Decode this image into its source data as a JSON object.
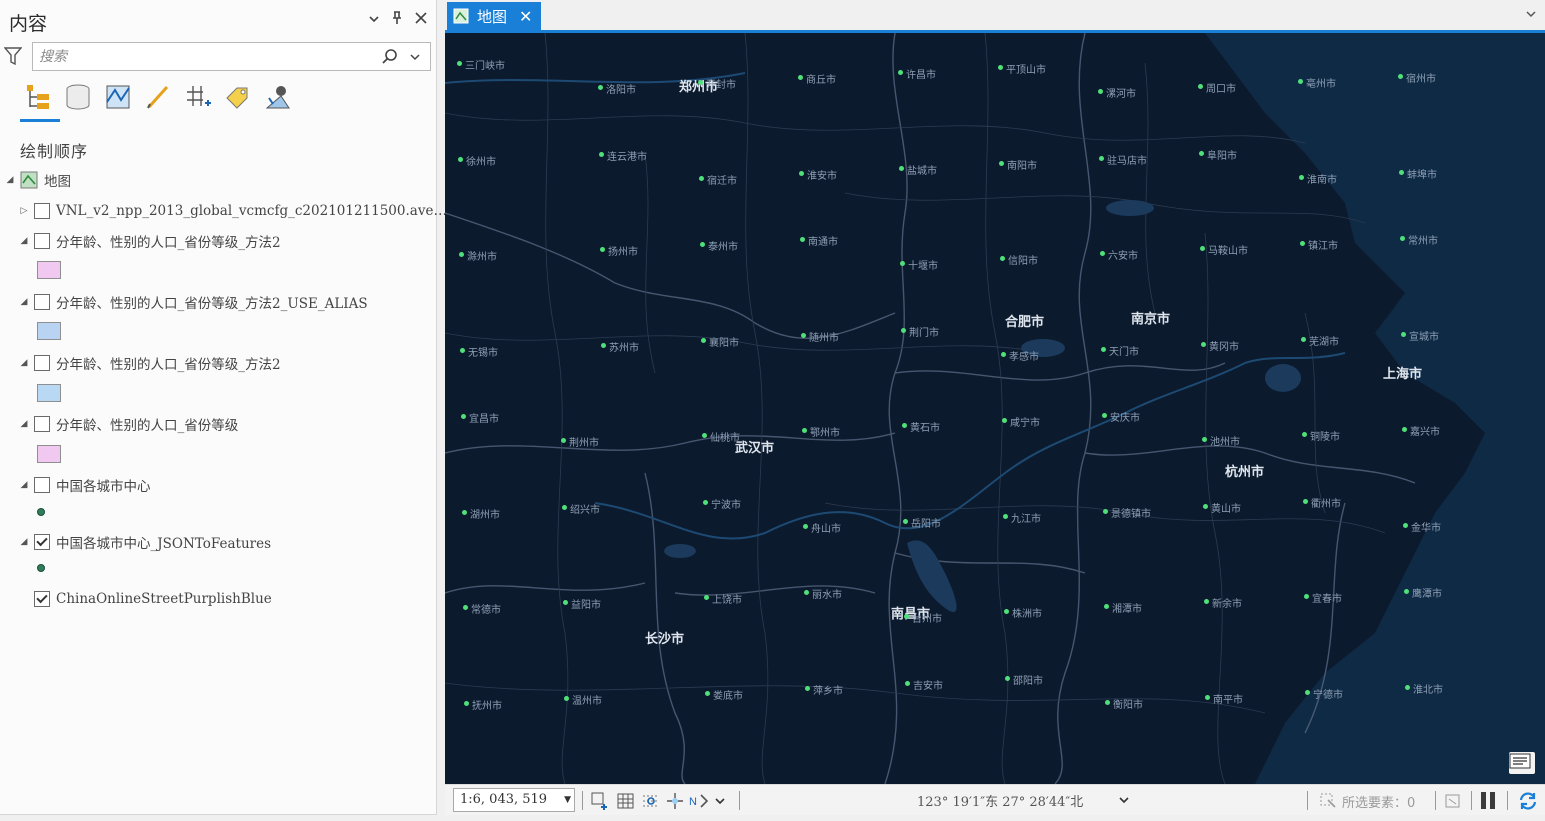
{
  "contents_pane": {
    "title": "内容",
    "search_placeholder": "搜索",
    "section_title": "绘制顺序",
    "map_node": "地图",
    "layers": [
      {
        "label": "VNL_v2_npp_2013_global_vcmcfg_c202101211500.ave…",
        "checked": false
      },
      {
        "label": "分年龄、性别的人口_省份等级_方法2",
        "checked": false,
        "swatch": "#f0c8f0"
      },
      {
        "label": "分年龄、性别的人口_省份等级_方法2_USE_ALIAS",
        "checked": false,
        "swatch": "#b8d4f2"
      },
      {
        "label": "分年龄、性别的人口_省份等级_方法2",
        "checked": false,
        "swatch": "#b8d8f4"
      },
      {
        "label": "分年龄、性别的人口_省份等级",
        "checked": false,
        "swatch": "#f0c8f0"
      },
      {
        "label": "中国各城市中心",
        "checked": false
      },
      {
        "label": "中国各城市中心_JSONToFeatures",
        "checked": true
      },
      {
        "label": "ChinaOnlineStreetPurplishBlue",
        "checked": true
      }
    ],
    "toolbar_icons": [
      "draw-order-icon",
      "data-source-icon",
      "selection-icon",
      "editing-icon",
      "snapping-icon",
      "labeling-icon",
      "perspective-imagery-icon"
    ]
  },
  "map_view": {
    "tab_label": "地图",
    "scale": "1:6, 043, 519",
    "coordinates": "123°  19′1″东  27°  28′44″北",
    "selected_features": "所选要素：0",
    "cities_major": [
      {
        "name": "郑州市"
      },
      {
        "name": "合肥市"
      },
      {
        "name": "南京市"
      },
      {
        "name": "上海市"
      },
      {
        "name": "武汉市"
      },
      {
        "name": "杭州市"
      },
      {
        "name": "南昌市"
      },
      {
        "name": "长沙市"
      }
    ],
    "cities_minor": [
      "三门峡市",
      "洛阳市",
      "开封市",
      "商丘市",
      "许昌市",
      "平顶山市",
      "漯河市",
      "周口市",
      "亳州市",
      "宿州市",
      "徐州市",
      "连云港市",
      "宿迁市",
      "淮安市",
      "盐城市",
      "南阳市",
      "驻马店市",
      "阜阳市",
      "淮南市",
      "蚌埠市",
      "滁州市",
      "扬州市",
      "泰州市",
      "南通市",
      "十堰市",
      "信阳市",
      "六安市",
      "马鞍山市",
      "镇江市",
      "常州市",
      "无锡市",
      "苏州市",
      "襄阳市",
      "随州市",
      "荆门市",
      "孝感市",
      "天门市",
      "黄冈市",
      "芜湖市",
      "宣城市",
      "宜昌市",
      "荆州市",
      "仙桃市",
      "鄂州市",
      "黄石市",
      "咸宁市",
      "安庆市",
      "池州市",
      "铜陵市",
      "嘉兴市",
      "湖州市",
      "绍兴市",
      "宁波市",
      "舟山市",
      "岳阳市",
      "九江市",
      "景德镇市",
      "黄山市",
      "衢州市",
      "金华市",
      "常德市",
      "益阳市",
      "上饶市",
      "丽水市",
      "台州市",
      "株洲市",
      "湘潭市",
      "新余市",
      "宜春市",
      "鹰潭市",
      "抚州市",
      "温州市",
      "娄底市",
      "萍乡市",
      "吉安市",
      "邵阳市",
      "衡阳市",
      "南平市",
      "宁德市",
      "淮北市"
    ]
  }
}
